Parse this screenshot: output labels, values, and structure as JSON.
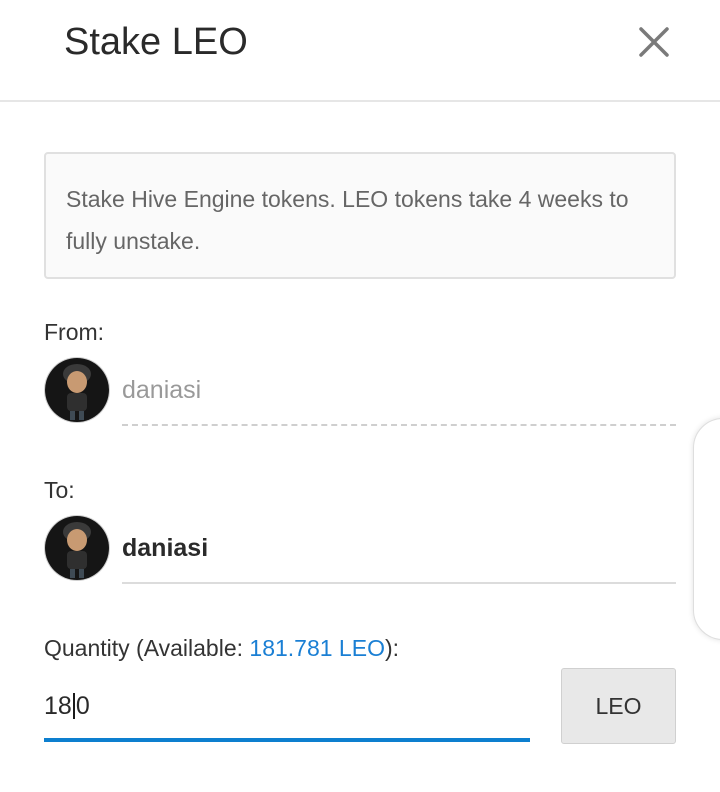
{
  "dialog": {
    "title": "Stake LEO",
    "close_icon": "close-icon"
  },
  "info": {
    "text": "Stake Hive Engine tokens. LEO tokens take 4 weeks to fully unstake."
  },
  "from": {
    "label": "From:",
    "username": "daniasi",
    "avatar_icon": "user-avatar"
  },
  "to": {
    "label": "To:",
    "username": "daniasi",
    "avatar_icon": "user-avatar"
  },
  "quantity": {
    "label_prefix": "Quantity (Available: ",
    "available": "181.781 LEO",
    "label_suffix": "):",
    "value_before_caret": "18",
    "value_after_caret": "0",
    "unit_button": "LEO"
  },
  "colors": {
    "accent": "#0d7fcf",
    "link": "#1a7fd4"
  }
}
